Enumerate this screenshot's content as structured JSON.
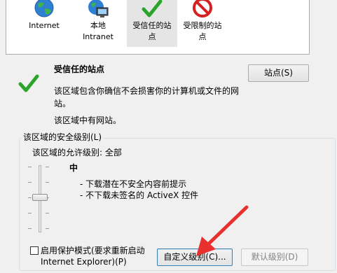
{
  "zones": [
    {
      "label_line1": "Internet",
      "label_line2": "",
      "icon": "globe-icon"
    },
    {
      "label_line1": "本地",
      "label_line2": "Intranet",
      "icon": "intranet-icon"
    },
    {
      "label_line1": "受信任的站",
      "label_line2": "点",
      "icon": "checkmark-icon"
    },
    {
      "label_line1": "受限制的站",
      "label_line2": "点",
      "icon": "restricted-icon"
    }
  ],
  "selected_zone": {
    "title": "受信任的站点",
    "description_line1": "该区域包含你确信不会损害你的计算机或文件的网",
    "description_line2": "站。",
    "status": "该区域中有网站。",
    "sites_button": "站点(S)"
  },
  "security_level": {
    "group_title": "该区域的安全级别(L)",
    "allowed_levels": "该区域的允许级别: 全部",
    "level_name": "中",
    "bullets": [
      "- 下载潜在不安全内容前提示",
      "- 不下载未签名的 ActiveX 控件"
    ],
    "slider_level": "中"
  },
  "protected_mode": {
    "label_line1": "启用保护模式(要求重新启动",
    "label_line2": "Internet Explorer)(P)",
    "checked": false
  },
  "buttons": {
    "custom_level": "自定义级别(C)...",
    "default_level": "默认级别(D)"
  },
  "colors": {
    "accent_check": "#2aa52a",
    "restricted_red": "#d42020",
    "annotation_arrow": "#e8312f"
  }
}
